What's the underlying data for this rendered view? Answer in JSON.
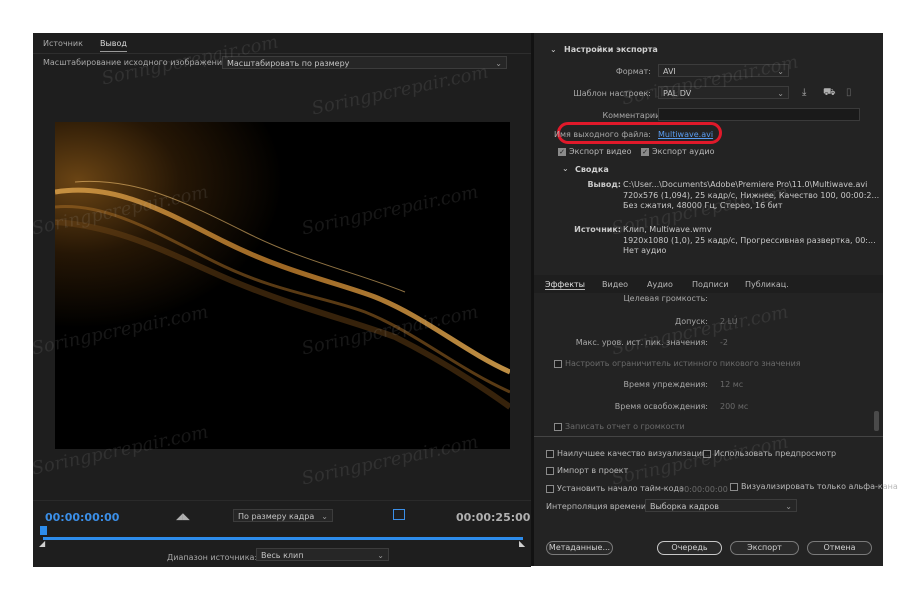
{
  "left": {
    "tabs": [
      "Источник",
      "Вывод"
    ],
    "scaling_label": "Масштабирование исходного изображения:",
    "scaling_value": "Масштабировать по размеру",
    "timecode_start": "00:00:00:00",
    "timecode_end": "00:00:25:00",
    "fit_value": "По размеру кадра",
    "range_label": "Диапазон источника:",
    "range_value": "Весь клип"
  },
  "export": {
    "section_title": "Настройки экспорта",
    "format_label": "Формат:",
    "format_value": "AVI",
    "preset_label": "Шаблон настроек:",
    "preset_value": "PAL DV",
    "comment_label": "Комментарии:",
    "output_label": "Имя выходного файла:",
    "output_value": "Multiwave.avi",
    "export_video": "Экспорт видео",
    "export_audio": "Экспорт аудио",
    "summary_title": "Сводка",
    "output_key": "Вывод:",
    "output_lines": [
      "C:\\User...\\Documents\\Adobe\\Premiere Pro\\11.0\\Multiwave.avi",
      "720x576 (1,094), 25 кадр/с, Нижнее, Качество 100, 00:00:2...",
      "Без сжатия, 48000 Гц, Стерео, 16 бит"
    ],
    "source_key": "Источник:",
    "source_lines": [
      "Клип, Multiwave.wmv",
      "1920x1080 (1,0), 25 кадр/с, Прогрессивная развертка, 00:...",
      "Нет аудио"
    ]
  },
  "tabs2": [
    "Эффекты",
    "Видео",
    "Аудио",
    "Подписи",
    "Публикац."
  ],
  "effects": {
    "target_loudness": "Целевая громкость:",
    "tolerance_label": "Допуск:",
    "tolerance_value": "2 LU",
    "max_peak_label": "Макс. уров. ист. пик. значения:",
    "max_peak_value": "-2",
    "limiter_label": "Настроить ограничитель истинного пикового значения",
    "lookahead_label": "Время упреждения:",
    "lookahead_value": "12 мс",
    "release_label": "Время освобождения:",
    "release_value": "200 мс",
    "write_report": "Записать отчет о громкости"
  },
  "bottom": {
    "max_quality": "Наилучшее качество визуализации",
    "use_previews": "Использовать предпросмотр",
    "import_project": "Импорт в проект",
    "set_timecode": "Установить начало тайм-кода",
    "timecode_value": "00:00:00:00",
    "alpha_only": "Визуализировать только альфа-кана",
    "interp_label": "Интерполяция времени:",
    "interp_value": "Выборка кадров",
    "metadata_btn": "Метаданные...",
    "queue_btn": "Очередь",
    "export_btn": "Экспорт",
    "cancel_btn": "Отмена"
  },
  "watermark": "Soringpcrepair.com",
  "colors": {
    "accent": "#2d8ceb",
    "highlight": "#e0192a",
    "link": "#5a9cf0"
  }
}
